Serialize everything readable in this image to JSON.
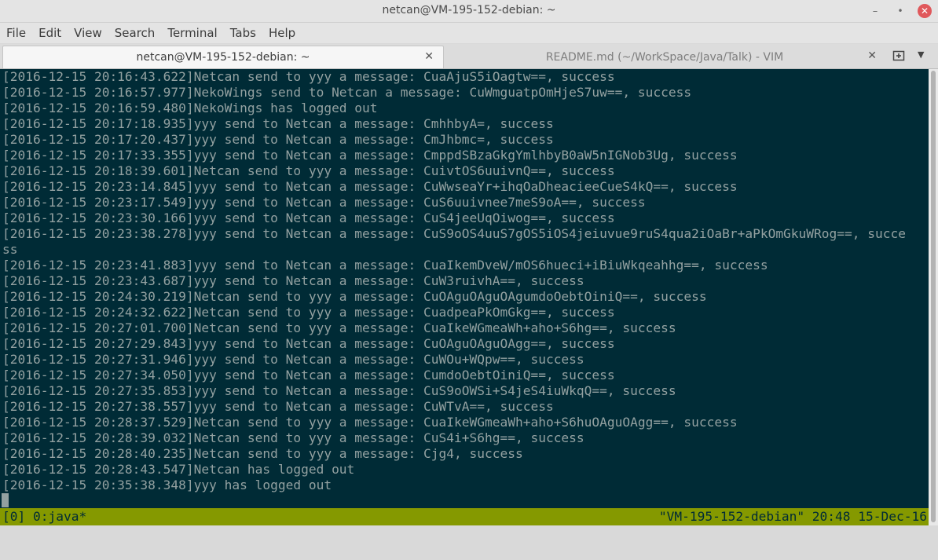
{
  "window": {
    "title": "netcan@VM-195-152-debian: ~",
    "minimize_icon": "minimize-icon",
    "maximize_icon": "maximize-icon",
    "close_icon": "close-icon"
  },
  "menubar": {
    "items": [
      "File",
      "Edit",
      "View",
      "Search",
      "Terminal",
      "Tabs",
      "Help"
    ]
  },
  "tabs": [
    {
      "label": "netcan@VM-195-152-debian: ~",
      "active": true
    },
    {
      "label": "README.md (~/WorkSpace/Java/Talk) - VIM",
      "active": false
    }
  ],
  "terminal": {
    "lines": [
      "[2016-12-15 20:16:43.622]Netcan send to yyy a message: CuaAjuS5iOagtw==, success",
      "[2016-12-15 20:16:57.977]NekoWings send to Netcan a message: CuWmguatpOmHjeS7uw==, success",
      "[2016-12-15 20:16:59.480]NekoWings has logged out",
      "[2016-12-15 20:17:18.935]yyy send to Netcan a message: CmhhbyA=, success",
      "[2016-12-15 20:17:20.437]yyy send to Netcan a message: CmJhbmc=, success",
      "[2016-12-15 20:17:33.355]yyy send to Netcan a message: CmppdSBzaGkgYmlhbyB0aW5nIGNob3Ug, success",
      "[2016-12-15 20:18:39.601]Netcan send to yyy a message: CuivtOS6uuivnQ==, success",
      "[2016-12-15 20:23:14.845]yyy send to Netcan a message: CuWwseaYr+ihqOaDheacieeCueS4kQ==, success",
      "[2016-12-15 20:23:17.549]yyy send to Netcan a message: CuS6uuivnee7meS9oA==, success",
      "[2016-12-15 20:23:30.166]yyy send to Netcan a message: CuS4jeeUqOiwog==, success",
      "[2016-12-15 20:23:38.278]yyy send to Netcan a message: CuS9oOS4uuS7gOS5iOS4jeiuvue9ruS4qua2iOaBr+aPkOmGkuWRog==, succe",
      "ss",
      "[2016-12-15 20:23:41.883]yyy send to Netcan a message: CuaIkemDveW/mOS6hueci+iBiuWkqeahhg==, success",
      "[2016-12-15 20:23:43.687]yyy send to Netcan a message: CuW3ruivhA==, success",
      "[2016-12-15 20:24:30.219]Netcan send to yyy a message: CuOAguOAguOAgumdoOebtOiniQ==, success",
      "[2016-12-15 20:24:32.622]Netcan send to yyy a message: CuadpeaPkOmGkg==, success",
      "[2016-12-15 20:27:01.700]Netcan send to yyy a message: CuaIkeWGmeaWh+aho+S6hg==, success",
      "[2016-12-15 20:27:29.843]yyy send to Netcan a message: CuOAguOAguOAgg==, success",
      "[2016-12-15 20:27:31.946]yyy send to Netcan a message: CuWOu+WQpw==, success",
      "[2016-12-15 20:27:34.050]yyy send to Netcan a message: CumdoOebtOiniQ==, success",
      "[2016-12-15 20:27:35.853]yyy send to Netcan a message: CuS9oOWSi+S4jeS4iuWkqQ==, success",
      "[2016-12-15 20:27:38.557]yyy send to Netcan a message: CuWTvA==, success",
      "[2016-12-15 20:28:37.529]Netcan send to yyy a message: CuaIkeWGmeaWh+aho+S6huOAguOAgg==, success",
      "[2016-12-15 20:28:39.032]Netcan send to yyy a message: CuS4i+S6hg==, success",
      "[2016-12-15 20:28:40.235]Netcan send to yyy a message: Cjg4, success",
      "[2016-12-15 20:28:43.547]Netcan has logged out",
      "[2016-12-15 20:35:38.348]yyy has logged out"
    ]
  },
  "statusbar": {
    "left": "[0] 0:java*",
    "right": "\"VM-195-152-debian\" 20:48 15-Dec-16"
  },
  "colors": {
    "terminal_bg": "#002b36",
    "terminal_fg": "#93a1a1",
    "statusbar_bg": "#859900",
    "close_button": "#e0585b"
  }
}
